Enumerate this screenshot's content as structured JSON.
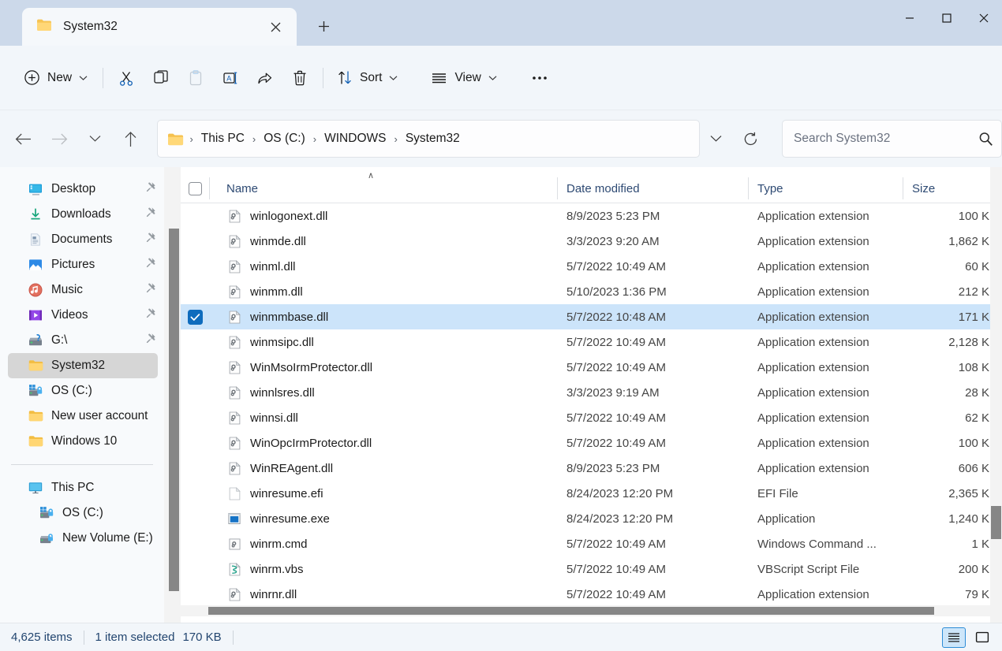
{
  "window": {
    "tab_title": "System32",
    "tab_icon": "folder-icon",
    "close_tab_label": "✕",
    "new_tab_label": "+",
    "minimize_label": "—",
    "maximize_label": "□",
    "close_label": "✕",
    "titlebar_color": "#ccd9ea"
  },
  "toolbar": {
    "new_label": "New",
    "new_icon": "plus-circle-icon",
    "cut_icon": "scissors-icon",
    "copy_icon": "copy-icon",
    "paste_icon": "clipboard-icon",
    "rename_icon": "rename-icon",
    "share_icon": "share-icon",
    "delete_icon": "trash-icon",
    "sort_label": "Sort",
    "sort_icon": "sort-arrows-icon",
    "view_label": "View",
    "view_icon": "list-lines-icon",
    "more_label": "•••",
    "chevron": "⌄"
  },
  "address": {
    "back_icon": "arrow-left-icon",
    "forward_icon": "arrow-right-icon",
    "recent_icon": "chevron-down-icon",
    "up_icon": "arrow-up-icon",
    "root_icon": "folder-icon",
    "crumbs": [
      "This PC",
      "OS (C:)",
      "WINDOWS",
      "System32"
    ],
    "separator": "›",
    "dropdown_icon": "chevron-down-icon",
    "refresh_icon": "refresh-icon"
  },
  "search": {
    "placeholder": "Search System32",
    "value": "",
    "icon": "search-icon"
  },
  "sidebar": {
    "quick_access": [
      {
        "label": "Desktop",
        "icon": "desktop-icon",
        "pinned": true
      },
      {
        "label": "Downloads",
        "icon": "download-icon",
        "pinned": true
      },
      {
        "label": "Documents",
        "icon": "document-icon",
        "pinned": true
      },
      {
        "label": "Pictures",
        "icon": "pictures-icon",
        "pinned": true
      },
      {
        "label": "Music",
        "icon": "music-icon",
        "pinned": true
      },
      {
        "label": "Videos",
        "icon": "video-icon",
        "pinned": true
      },
      {
        "label": "G:\\",
        "icon": "drive-unknown-icon",
        "pinned": true
      },
      {
        "label": "System32",
        "icon": "folder-icon",
        "pinned": false,
        "selected": true
      },
      {
        "label": "OS (C:)",
        "icon": "windows-drive-icon",
        "pinned": false
      },
      {
        "label": "New user account",
        "icon": "folder-icon",
        "pinned": false
      },
      {
        "label": "Windows 10",
        "icon": "folder-icon",
        "pinned": false
      }
    ],
    "this_pc": [
      {
        "label": "This PC",
        "icon": "monitor-icon",
        "indent": false
      },
      {
        "label": "OS (C:)",
        "icon": "windows-drive-icon",
        "indent": true
      },
      {
        "label": "New Volume (E:)",
        "icon": "drive-icon",
        "indent": true
      }
    ]
  },
  "filelist": {
    "columns": {
      "name": "Name",
      "date_modified": "Date modified",
      "type": "Type",
      "size": "Size"
    },
    "sort_indicator": "∧",
    "rows": [
      {
        "name": "winlogonext.dll",
        "date": "8/9/2023 5:23 PM",
        "type": "Application extension",
        "size": "100 K",
        "icon": "dll-icon",
        "selected": false
      },
      {
        "name": "winmde.dll",
        "date": "3/3/2023 9:20 AM",
        "type": "Application extension",
        "size": "1,862 K",
        "icon": "dll-icon",
        "selected": false
      },
      {
        "name": "winml.dll",
        "date": "5/7/2022 10:49 AM",
        "type": "Application extension",
        "size": "60 K",
        "icon": "dll-icon",
        "selected": false
      },
      {
        "name": "winmm.dll",
        "date": "5/10/2023 1:36 PM",
        "type": "Application extension",
        "size": "212 K",
        "icon": "dll-icon",
        "selected": false
      },
      {
        "name": "winmmbase.dll",
        "date": "5/7/2022 10:48 AM",
        "type": "Application extension",
        "size": "171 K",
        "icon": "dll-icon",
        "selected": true
      },
      {
        "name": "winmsipc.dll",
        "date": "5/7/2022 10:49 AM",
        "type": "Application extension",
        "size": "2,128 K",
        "icon": "dll-icon",
        "selected": false
      },
      {
        "name": "WinMsoIrmProtector.dll",
        "date": "5/7/2022 10:49 AM",
        "type": "Application extension",
        "size": "108 K",
        "icon": "dll-icon",
        "selected": false
      },
      {
        "name": "winnlsres.dll",
        "date": "3/3/2023 9:19 AM",
        "type": "Application extension",
        "size": "28 K",
        "icon": "dll-icon",
        "selected": false
      },
      {
        "name": "winnsi.dll",
        "date": "5/7/2022 10:49 AM",
        "type": "Application extension",
        "size": "62 K",
        "icon": "dll-icon",
        "selected": false
      },
      {
        "name": "WinOpcIrmProtector.dll",
        "date": "5/7/2022 10:49 AM",
        "type": "Application extension",
        "size": "100 K",
        "icon": "dll-icon",
        "selected": false
      },
      {
        "name": "WinREAgent.dll",
        "date": "8/9/2023 5:23 PM",
        "type": "Application extension",
        "size": "606 K",
        "icon": "dll-icon",
        "selected": false
      },
      {
        "name": "winresume.efi",
        "date": "8/24/2023 12:20 PM",
        "type": "EFI File",
        "size": "2,365 K",
        "icon": "blank-file-icon",
        "selected": false
      },
      {
        "name": "winresume.exe",
        "date": "8/24/2023 12:20 PM",
        "type": "Application",
        "size": "1,240 K",
        "icon": "exe-icon",
        "selected": false
      },
      {
        "name": "winrm.cmd",
        "date": "5/7/2022 10:49 AM",
        "type": "Windows Command ...",
        "size": "1 K",
        "icon": "cmd-icon",
        "selected": false
      },
      {
        "name": "winrm.vbs",
        "date": "5/7/2022 10:49 AM",
        "type": "VBScript Script File",
        "size": "200 K",
        "icon": "vbs-icon",
        "selected": false
      },
      {
        "name": "winrnr.dll",
        "date": "5/7/2022 10:49 AM",
        "type": "Application extension",
        "size": "79 K",
        "icon": "dll-icon",
        "selected": false
      }
    ]
  },
  "statusbar": {
    "item_count": "4,625 items",
    "selection_count": "1 item selected",
    "selection_size": "170 KB",
    "details_view_icon": "details-view-icon",
    "tiles_view_icon": "large-icons-view-icon"
  },
  "colors": {
    "accent": "#0f6cbd",
    "selection": "#cce4fa",
    "titlebar": "#ccd9ea",
    "header_text": "#2e4a73"
  }
}
